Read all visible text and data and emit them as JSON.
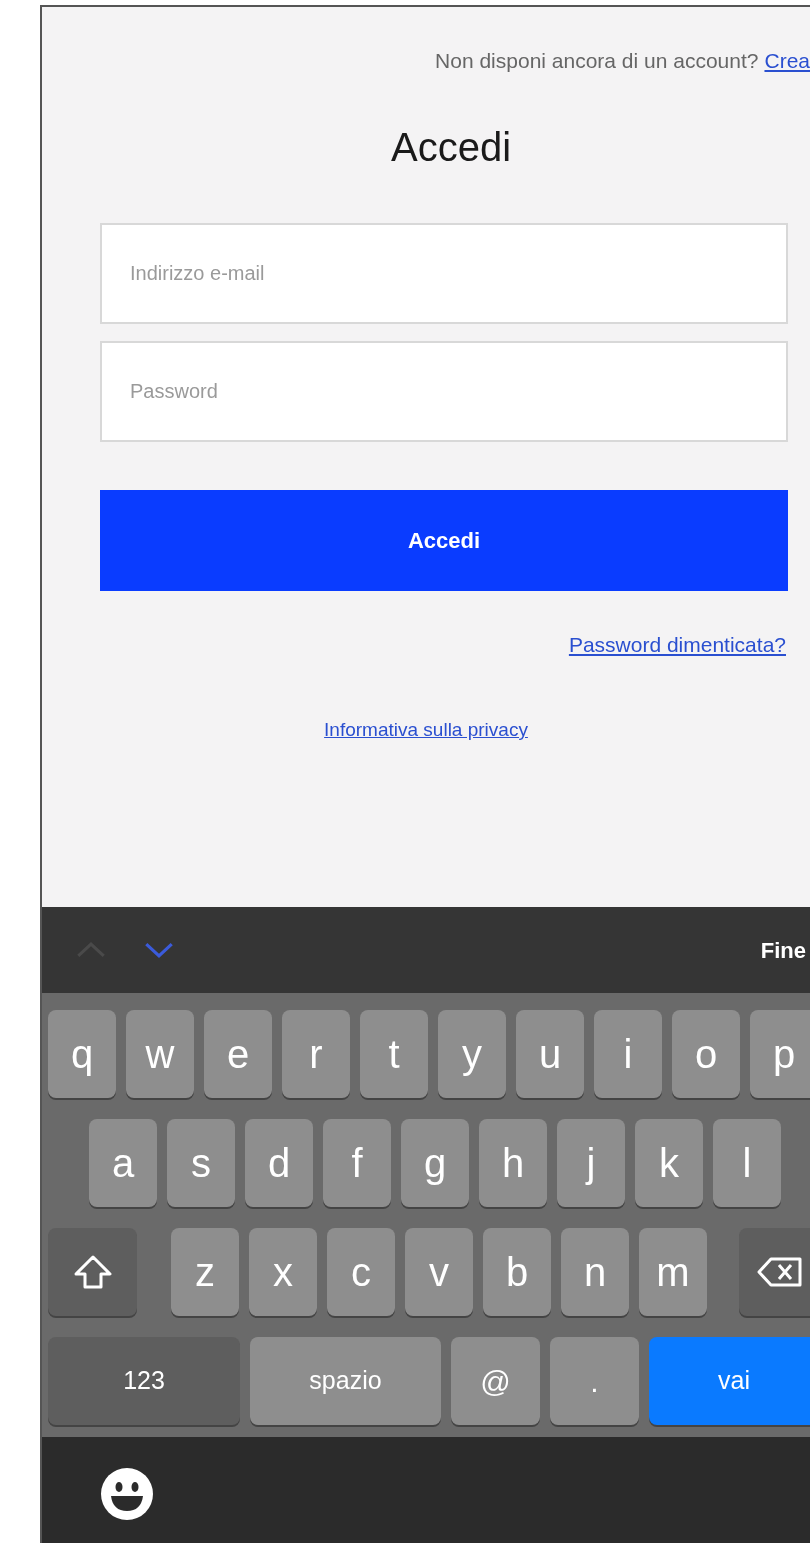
{
  "signup_prompt": {
    "text": "Non disponi ancora di un account?",
    "link": "Crea"
  },
  "title": "Accedi",
  "fields": [
    {
      "placeholder": "Indirizzo e-mail"
    },
    {
      "placeholder": "Password"
    }
  ],
  "submit_button": "Accedi",
  "forgot_link": "Password dimenticata?",
  "privacy_link": "Informativa sulla privacy",
  "keyboard": {
    "toolbar": {
      "nav": [
        {
          "kind": "up",
          "disabled": true
        },
        {
          "kind": "down",
          "disabled": false
        }
      ],
      "done": "Fine"
    },
    "rows": [
      {
        "keys": [
          {
            "kind": "letter",
            "label": "q"
          },
          {
            "kind": "letter",
            "label": "w"
          },
          {
            "kind": "letter",
            "label": "e"
          },
          {
            "kind": "letter",
            "label": "r"
          },
          {
            "kind": "letter",
            "label": "t"
          },
          {
            "kind": "letter",
            "label": "y"
          },
          {
            "kind": "letter",
            "label": "u"
          },
          {
            "kind": "letter",
            "label": "i"
          },
          {
            "kind": "letter",
            "label": "o"
          },
          {
            "kind": "letter",
            "label": "p"
          }
        ]
      },
      {
        "keys": [
          {
            "kind": "letter",
            "label": "a"
          },
          {
            "kind": "letter",
            "label": "s"
          },
          {
            "kind": "letter",
            "label": "d"
          },
          {
            "kind": "letter",
            "label": "f"
          },
          {
            "kind": "letter",
            "label": "g"
          },
          {
            "kind": "letter",
            "label": "h"
          },
          {
            "kind": "letter",
            "label": "j"
          },
          {
            "kind": "letter",
            "label": "k"
          },
          {
            "kind": "letter",
            "label": "l"
          }
        ]
      },
      {
        "keys": [
          {
            "kind": "shift"
          },
          {
            "kind": "letter",
            "label": "z"
          },
          {
            "kind": "letter",
            "label": "x"
          },
          {
            "kind": "letter",
            "label": "c"
          },
          {
            "kind": "letter",
            "label": "v"
          },
          {
            "kind": "letter",
            "label": "b"
          },
          {
            "kind": "letter",
            "label": "n"
          },
          {
            "kind": "letter",
            "label": "m"
          },
          {
            "kind": "backspace"
          }
        ]
      },
      {
        "keys": [
          {
            "kind": "mode",
            "label": "123"
          },
          {
            "kind": "space",
            "label": "spazio"
          },
          {
            "kind": "symbol",
            "label": "@"
          },
          {
            "kind": "symbol",
            "label": "."
          },
          {
            "kind": "go",
            "label": "vai"
          }
        ]
      }
    ]
  }
}
